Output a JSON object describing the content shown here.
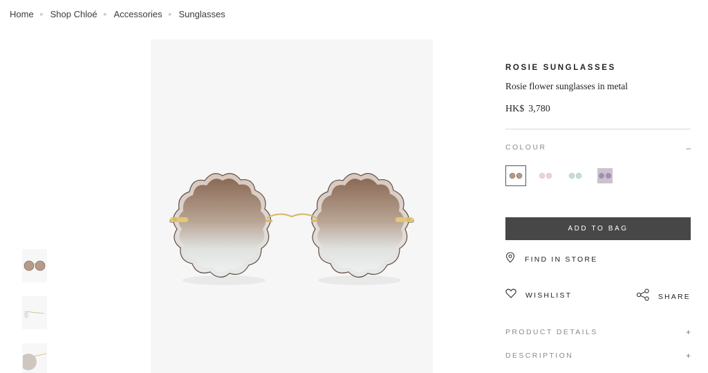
{
  "breadcrumb": [
    "Home",
    "Shop Chloé",
    "Accessories",
    "Sunglasses"
  ],
  "product": {
    "title": "ROSIE SUNGLASSES",
    "subtitle": "Rosie flower sunglasses in metal",
    "currency": "HK$",
    "price": "3,780"
  },
  "colour": {
    "label": "COLOUR",
    "toggle": "–",
    "swatches": [
      {
        "name": "brown gradient",
        "lens": "#b49a86",
        "selected": true
      },
      {
        "name": "pink",
        "lens": "#ead3d6",
        "selected": false
      },
      {
        "name": "light blue",
        "lens": "#c8dcdf",
        "selected": false
      },
      {
        "name": "purple mirror",
        "lens": "#a78ab4",
        "selected": false
      }
    ]
  },
  "actions": {
    "add_to_bag": "ADD TO BAG",
    "find_in_store": "FIND IN STORE",
    "wishlist": "WISHLIST",
    "share": "SHARE"
  },
  "accordions": {
    "details": {
      "label": "PRODUCT DETAILS",
      "icon": "+"
    },
    "description": {
      "label": "DESCRIPTION",
      "icon": "+"
    }
  },
  "colors": {
    "button_bg": "#474747",
    "image_bg": "#f6f6f6",
    "frame_gold": "#d8b968",
    "lens_top": "#8a6a55",
    "lens_bottom": "#e9ecec"
  },
  "icons": [
    "chevron-right-icon",
    "location-pin-icon",
    "heart-icon",
    "share-icon",
    "plus-icon",
    "minus-icon"
  ]
}
